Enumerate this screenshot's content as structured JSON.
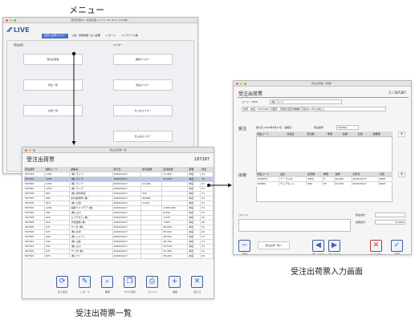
{
  "captions": {
    "menu": "メニュー",
    "list": "受注出荷票一覧",
    "input": "受注出荷票入力画面"
  },
  "colors": {
    "accent": "#3d5fa0",
    "tab_active": "#4a72c4",
    "row_selected": "#b9c9e4",
    "danger": "#c0392b"
  },
  "menu": {
    "window_title": "販売管理DX / 在庫管理システム Ver. 62.4（LIVE版）",
    "logo": "LIVE",
    "tabs": [
      "出荷入出荷マスター",
      "入金・請求処理 / 仕入処理",
      "レポート",
      "メンテナンス等"
    ],
    "left_heading": "受注出荷",
    "right_heading": "マスター",
    "left_buttons": [
      "受注出荷票",
      "受注一覧",
      "出荷一覧"
    ],
    "right_buttons": [
      "顧客マスター",
      "商品マスター",
      "仕入先マスター",
      "仕入品マスター"
    ]
  },
  "list": {
    "window_title": "受注出荷票一覧",
    "title": "受注出荷票",
    "count": "187287",
    "headers": [
      "受注番号",
      "顧客コード",
      "顧客名",
      "受付日",
      "受注金額",
      "出荷金額",
      "部署",
      "担当"
    ],
    "rows": [
      [
        "567545",
        "1254",
        "(株) ライブ",
        "2020/04/17",
        "",
        "17,000",
        "本店",
        "31"
      ],
      [
        "567544",
        "1254",
        "(株) ライブ",
        "2020/04/17",
        "",
        "41,000",
        "本店",
        "31"
      ],
      [
        "567543",
        "1254",
        "(株) ライブ",
        "2020/04/17",
        "12,400",
        "",
        "本店",
        "31"
      ],
      [
        "567542",
        "1254",
        "(株) ライブ",
        "2020/04/17",
        "",
        "",
        "本店",
        "31"
      ],
      [
        "567539",
        "824",
        "(株) 田中商店",
        "2020/04/17",
        "520",
        "",
        "本店",
        "31"
      ],
      [
        "567537",
        "282",
        "鈴木製作所 (株)",
        "2020/04/17",
        "26,800",
        "",
        "本店",
        "31"
      ],
      [
        "567535",
        "416",
        "(株) 山田",
        "2020/04/17",
        "3,040",
        "",
        "本店",
        "31"
      ],
      [
        "567533",
        "1232",
        "佐藤ファニチア (株)",
        "2020/04/17",
        "",
        "1,584,000",
        "本店",
        "31"
      ],
      [
        "567529",
        "202",
        "(株) 山川",
        "2020/04/17",
        "",
        "6,652",
        "本店",
        "21"
      ],
      [
        "567528",
        "624",
        "エスモ木工 (株)",
        "2020/04/17",
        "",
        "1,670",
        "本店",
        "20"
      ],
      [
        "567526",
        "216",
        "大阪金物 (株)",
        "2020/04/17",
        "",
        "1,663",
        "本店",
        "20"
      ],
      [
        "567525",
        "247",
        "サンダ (株)",
        "2020/04/17",
        "",
        "38,000",
        "本店",
        "31"
      ],
      [
        "567524",
        "374",
        "(株) 丸松",
        "2020/04/17",
        "",
        "87,000",
        "本店",
        "20"
      ],
      [
        "567522",
        "590",
        "(株) ジャパン",
        "2020/04/17",
        "",
        "36,500",
        "本店",
        "31"
      ],
      [
        "567521",
        "104",
        "(株) 山谷",
        "2020/04/17",
        "",
        "38,192",
        "本店",
        "31"
      ],
      [
        "567521",
        "202",
        "(株) 山川",
        "2020/04/17",
        "",
        "22,528",
        "本店",
        "31"
      ],
      [
        "567520",
        "247",
        "サンダ (株)",
        "2020/04/17",
        "",
        "51,300",
        "本店",
        "31"
      ],
      [
        "567519",
        "879",
        "(株) ワン",
        "2020/04/17",
        "",
        "38,400",
        "本店",
        "20"
      ]
    ],
    "toolbar": [
      {
        "icon": "refresh-icon",
        "glyph": "⟳",
        "label": "全て表示"
      },
      {
        "icon": "report-icon",
        "glyph": "✎",
        "label": "レポート"
      },
      {
        "icon": "search-icon",
        "glyph": "⌕",
        "label": "検索"
      },
      {
        "icon": "copy-icon",
        "glyph": "❐",
        "label": "すべて表示"
      },
      {
        "icon": "print-icon",
        "glyph": "⎙",
        "label": "プリント"
      },
      {
        "icon": "add-icon",
        "glyph": "+",
        "label": "追加"
      },
      {
        "icon": "close-icon",
        "glyph": "✕",
        "label": "閉じる"
      }
    ]
  },
  "input": {
    "window_title": "受注出荷票（詳細）",
    "title": "受注出荷票",
    "page": "2",
    "total": "187287",
    "customer_code": "コード：1254",
    "customer_name": "(株) ライブ",
    "address": "住所　本店　530-0041 大阪府　大阪市北区天神橋2丁目北2-1８(小林ビル",
    "order_label": "受注",
    "order_info": "受付日 2020年4月17日　金曜日",
    "order_no_label": "受注番号",
    "order_no": "567544",
    "order_headers": [
      "商品コード",
      "商品名",
      "受注数",
      "単価",
      "金額",
      "仕様",
      "摘要等"
    ],
    "ship_label": "出荷",
    "ship_headers": [
      "商品コード",
      "品名",
      "出荷数",
      "単価",
      "金額",
      "出荷日",
      "伝票"
    ],
    "ship_rows": [
      [
        "1004932",
        "テーブルA1",
        "4000",
        "5",
        "20,000",
        "2020/04/17",
        "0000"
      ],
      [
        "000824",
        "チェアセット",
        "600",
        "35",
        "21,000",
        "2020/04/17",
        "0000"
      ]
    ],
    "comment_label": "コメント",
    "total_label": "受注合計",
    "ship_total_label": "出荷合計",
    "ship_total": "41,000",
    "footer": [
      {
        "icon": "minus-icon",
        "glyph": "−",
        "label": "削除"
      },
      {
        "icon": "prev-icon",
        "glyph": "◀",
        "label": "前レコード"
      },
      {
        "icon": "next-icon",
        "glyph": "▶",
        "label": "次レコード"
      },
      {
        "icon": "cancel-icon",
        "glyph": "✕",
        "label": "キャンセル"
      },
      {
        "icon": "check-icon",
        "glyph": "✓",
        "label": "保存"
      }
    ],
    "list_button": "受注出荷一覧へ"
  }
}
